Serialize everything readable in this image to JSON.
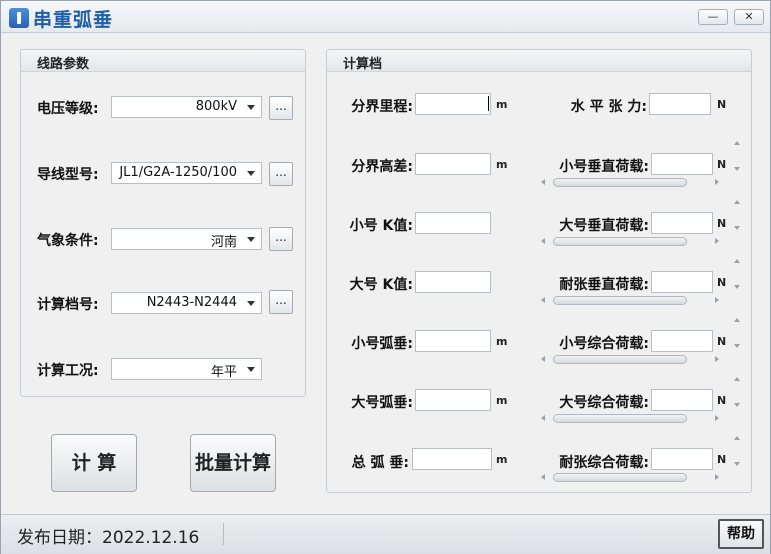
{
  "window": {
    "title": "串重弧垂",
    "minimize_label": "—",
    "close_label": "✕"
  },
  "line_params": {
    "title": "线路参数",
    "voltage": {
      "label": "电压等级:",
      "value": "800kV",
      "button": "..."
    },
    "conductor": {
      "label": "导线型号:",
      "value": "JL1/G2A-1250/100",
      "button": "..."
    },
    "weather": {
      "label": "气象条件:",
      "value": "河南",
      "button": "..."
    },
    "span": {
      "label": "计算档号:",
      "value": "N2443-N2444",
      "button": "..."
    },
    "condition": {
      "label": "计算工况:",
      "value": "年平"
    }
  },
  "buttons": {
    "calculate": "计  算",
    "batch": "批量计算"
  },
  "calc_span": {
    "title": "计算档",
    "left_rows": [
      {
        "label": "分界里程:",
        "unit": "m",
        "value": ""
      },
      {
        "label": "分界高差:",
        "unit": "m",
        "value": ""
      },
      {
        "label": "小号 K值:",
        "unit": "",
        "value": ""
      },
      {
        "label": "大号 K值:",
        "unit": "",
        "value": ""
      },
      {
        "label": "小号弧垂:",
        "unit": "m",
        "value": ""
      },
      {
        "label": "大号弧垂:",
        "unit": "m",
        "value": ""
      },
      {
        "label": "总 弧 垂:",
        "unit": "m",
        "value": ""
      }
    ],
    "right_rows": [
      {
        "label": "水 平 张 力:",
        "unit": "N",
        "value": ""
      },
      {
        "label": "小号垂直荷载:",
        "unit": "N",
        "value": ""
      },
      {
        "label": "大号垂直荷载:",
        "unit": "N",
        "value": ""
      },
      {
        "label": "耐张垂直荷载:",
        "unit": "N",
        "value": ""
      },
      {
        "label": "小号综合荷载:",
        "unit": "N",
        "value": ""
      },
      {
        "label": "大号综合荷载:",
        "unit": "N",
        "value": ""
      },
      {
        "label": "耐张综合荷载:",
        "unit": "N",
        "value": ""
      }
    ]
  },
  "status_bar": {
    "release_date": "发布日期：2022.12.16",
    "help": "帮助"
  }
}
